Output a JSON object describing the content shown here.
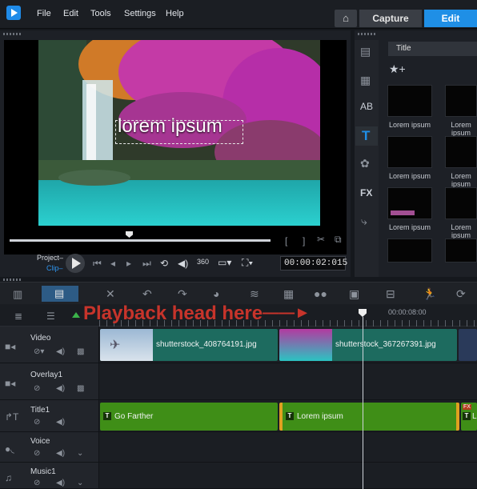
{
  "menu": {
    "items": [
      "File",
      "Edit",
      "Tools",
      "Settings",
      "Help"
    ]
  },
  "tabs": {
    "home": "⌂",
    "capture": "Capture",
    "edit": "Edit"
  },
  "preview": {
    "overlay_text": "lorem ipsum"
  },
  "player": {
    "project_label": "Project–",
    "clip_label": "Clip–",
    "timecode": "00:00:02:015"
  },
  "library": {
    "category": "Title",
    "thumbs": [
      {
        "label": "Lorem ipsum"
      },
      {
        "label": "Lorem ipsum"
      },
      {
        "label": "Lorem ipsum"
      },
      {
        "label": "Lorem ipsum"
      },
      {
        "label": "Lorem ipsum"
      },
      {
        "label": "Lorem ipsum"
      }
    ],
    "side_icons": [
      "media-icon",
      "instant-project-icon",
      "transition-icon",
      "title-icon",
      "graphics-icon",
      "fx-icon",
      "motion-path-icon"
    ],
    "fx_label": "FX"
  },
  "ruler": {
    "ticks": [
      "00:00:08:00"
    ]
  },
  "annotation": {
    "text": "Playback head here"
  },
  "tracks": [
    {
      "name": "Video",
      "clips": [
        {
          "text": "shutterstock_408764191.jpg"
        },
        {
          "text": "shutterstock_367267391.jpg"
        }
      ]
    },
    {
      "name": "Overlay1",
      "clips": []
    },
    {
      "name": "Title1",
      "clips": [
        {
          "text": "Go Farther"
        },
        {
          "text": "Lorem ipsum"
        },
        {
          "text": "L"
        }
      ]
    },
    {
      "name": "Voice",
      "clips": []
    },
    {
      "name": "Music1",
      "clips": []
    }
  ],
  "title_clip_badge": "T",
  "colors": {
    "accent": "#1f8fe6",
    "video_clip": "#1d6b5f",
    "title_clip": "#3f8e17",
    "annotation": "#c7342b"
  }
}
